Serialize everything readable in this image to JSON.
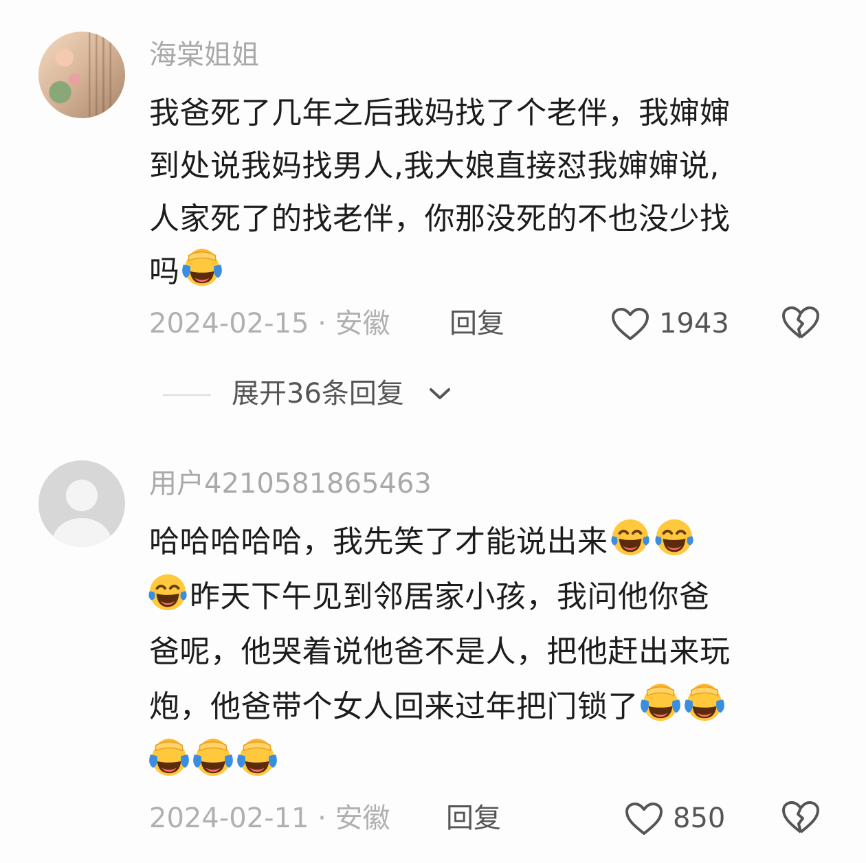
{
  "comments": [
    {
      "username": "海棠姐姐",
      "avatar": "photo-avatar",
      "text_lines": [
        "我爸死了几年之后我妈找了个老伴，我婶婶",
        "到处说我妈找男人,我大娘直接怼我婶婶说,",
        "人家死了的找老伴，你那没死的不也没少找",
        "吗"
      ],
      "emoji_after_last_line": [
        "facepalm-laugh-emoji"
      ],
      "date_location": "2024-02-15 · 安徽",
      "reply_label": "回复",
      "like_count": "1943"
    },
    {
      "username": "用户4210581865463",
      "avatar": "default-avatar",
      "line1_text": "哈哈哈哈哈，我先笑了才能说出来",
      "line2_text": "昨天下午见到邻居家小孩，我问他你爸",
      "line3_text": "爸呢，他哭着说他爸不是人，把他赶出来玩",
      "line4_text": "炮，他爸带个女人回来过年把门锁了",
      "date_location": "2024-02-11 · 安徽",
      "reply_label": "回复",
      "like_count": "850"
    }
  ],
  "expand_replies": {
    "label": "展开36条回复"
  },
  "colors": {
    "background": "#fdfdfd",
    "username": "#a9a9a9",
    "text": "#1c1c1c",
    "meta": "#b0b0b0",
    "action": "#555555",
    "emoji_face": "#ffc83d",
    "emoji_tears": "#3a8de0"
  }
}
